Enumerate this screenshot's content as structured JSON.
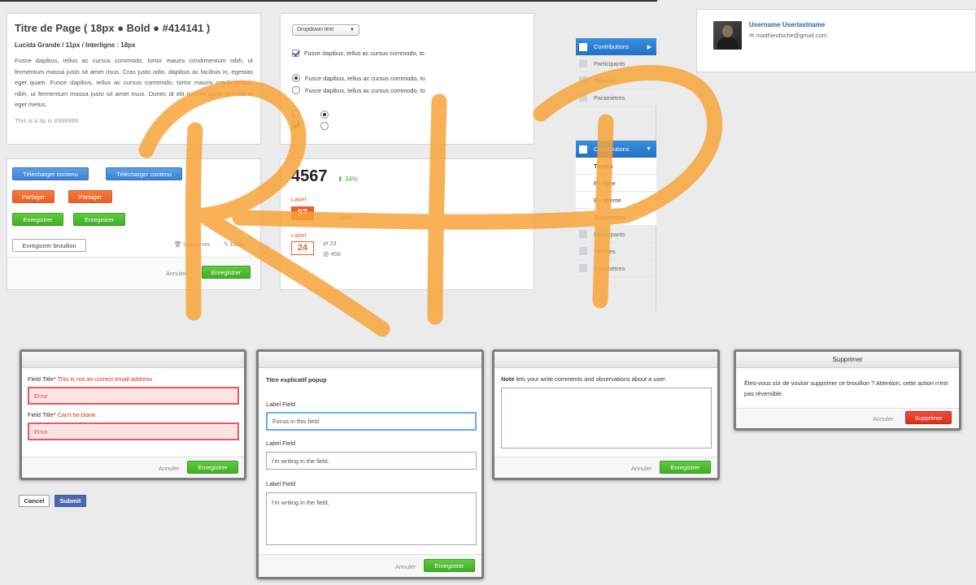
{
  "typography": {
    "title": "Titre de Page ( 18px ● Bold ● #414141 )",
    "subtitle": "Lucida Grande / 11px / Interligne : 18px",
    "body": "Fusce dapibus, tellus ac cursus commodo, tortor mauris condimentum nibh, ut fermentum massa justo sit amet risus. Cras justo odio, dapibus ac facilisis in, egestas eget quam. Fusce dapibus, tellus ac cursus commodo, tortor mauris condimentum nibh, ut fermentum massa justo sit amet risus. Donec id elit non mi porta gravida at eget metus.",
    "tip": "This is a tip in #999999"
  },
  "controls": {
    "dropdown_text": "Dropdown text",
    "checkbox_label": "Fusce dapibus, tellus ac cursus commodo, to",
    "radio1_label": "Fusce dapibus, tellus ac cursus commodo, to",
    "radio2_label": "Fusce dapibus, tellus ac cursus commodo, to"
  },
  "buttons": {
    "download": "Télécharger contenu",
    "share": "Partager",
    "save": "Enregistrer",
    "save_draft": "Enregistrer brouillon",
    "delete": "Supprimer",
    "edit": "Editer",
    "cancel": "Annuler"
  },
  "stats": {
    "big_number": "4567",
    "percent": "34%",
    "label1": "Label",
    "badge1": "97",
    "badge1_side": "Label",
    "label2": "Label",
    "badge2": "24",
    "retweets": "23",
    "mentions": "456"
  },
  "nav_top": [
    {
      "label": "Contributions",
      "active": true
    },
    {
      "label": "Participants",
      "active": false
    },
    {
      "label": "Thèmes",
      "active": false
    },
    {
      "label": "Paramètres",
      "active": false
    }
  ],
  "nav_bottom": {
    "header": "Contributions",
    "subitems": [
      "Toutes",
      "En ligne",
      "En attente",
      "Supprimées"
    ],
    "items": [
      "Participants",
      "Thèmes",
      "Paramètres"
    ]
  },
  "user": {
    "name": "Username Userlastname",
    "email": "matthieufoche@gmail.com"
  },
  "modal_errors": {
    "field_label": "Field Title",
    "error1": "This is not an correct email address",
    "error2": "Can't be blank",
    "field_value": "Error",
    "cancel": "Annuler",
    "save": "Enregistrer"
  },
  "modal_popup": {
    "title": "Titre explicatif popup",
    "label": "Label Field",
    "focus_value": "Focus in this field",
    "writing_value": "I'm writing in the field.",
    "cancel": "Annuler",
    "save": "Enregistrer"
  },
  "modal_note": {
    "note_bold": "Note",
    "note_rest": " lets your write comments and observations about a user.",
    "cancel": "Annuler",
    "save": "Enregistrer"
  },
  "modal_delete": {
    "title": "Supprimer",
    "message": "Êtes-vous sûr de vouloir supprimer ce brouillon ? Attention, cette action n'est pas réversible.",
    "cancel": "Annuler",
    "confirm": "Supprimer"
  },
  "form_buttons": {
    "cancel": "Cancel",
    "submit": "Submit"
  },
  "annotation": {
    "scribble_text": "RIP",
    "color": "#f7a43a"
  },
  "colors": {
    "blue": "#3b82d6",
    "orange": "#e8602a",
    "green": "#42ad27",
    "red": "#d9301e",
    "link": "#2b5fa8"
  }
}
